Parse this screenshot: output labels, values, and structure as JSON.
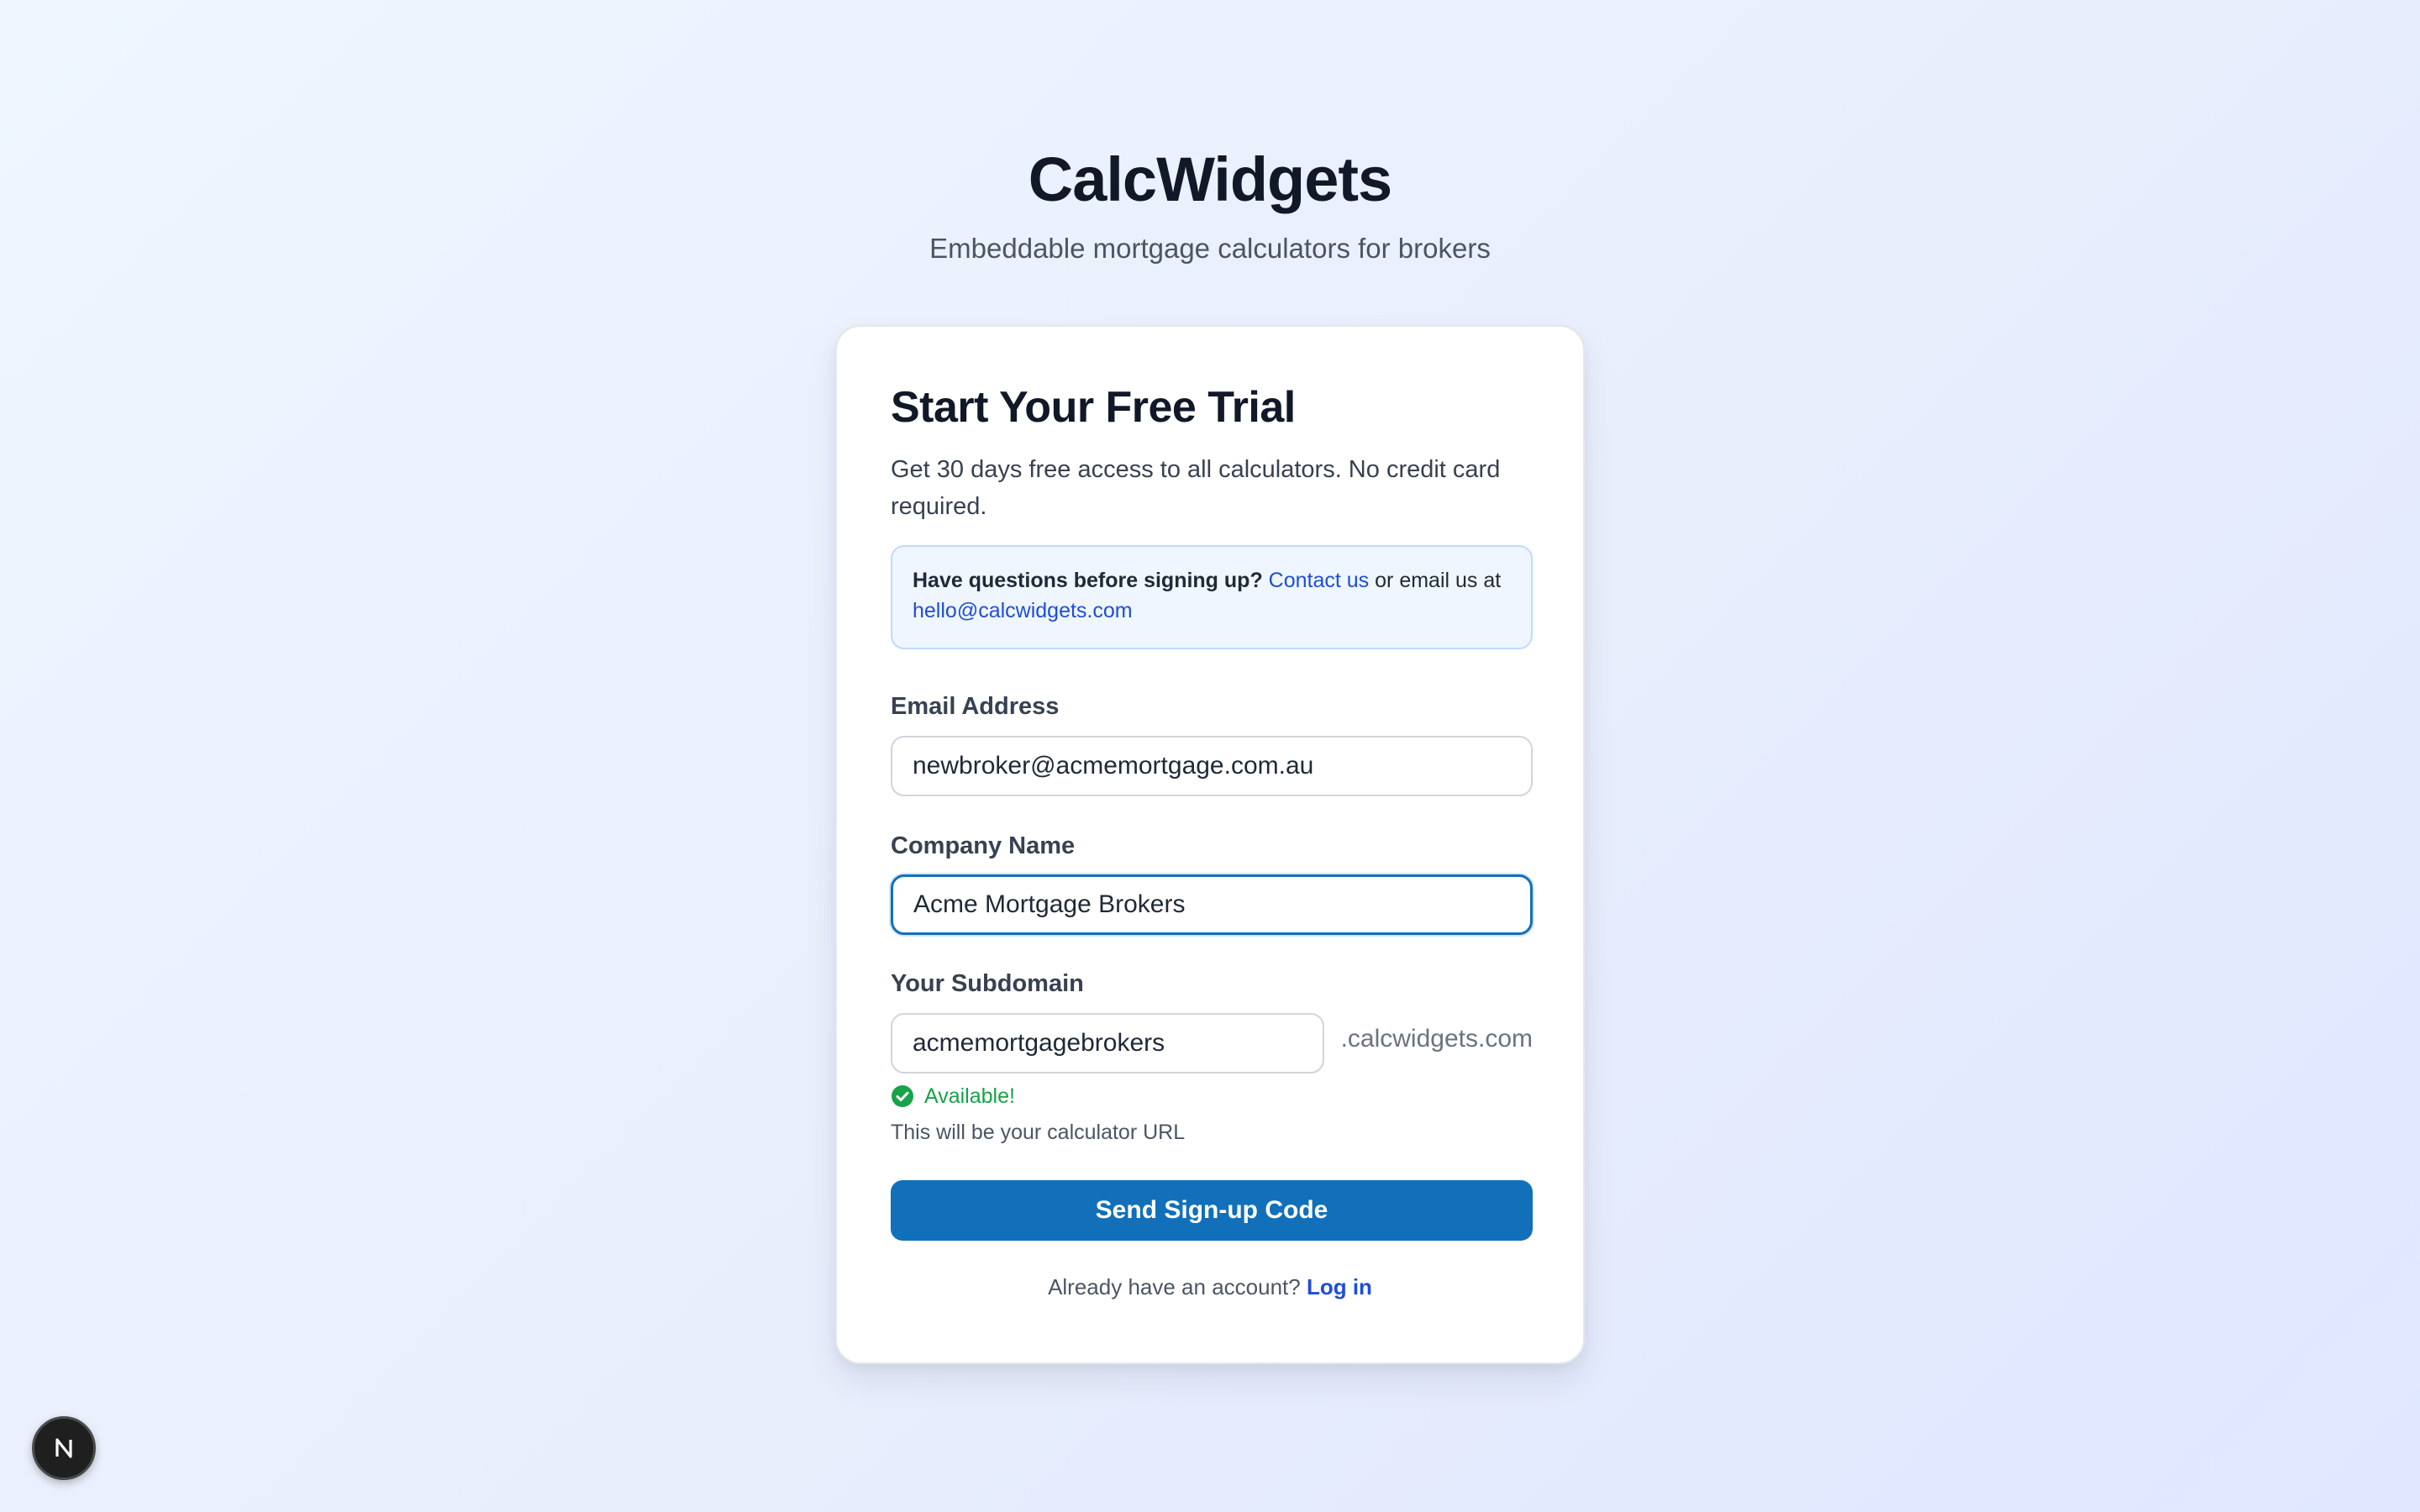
{
  "header": {
    "title": "CalcWidgets",
    "tagline": "Embeddable mortgage calculators for brokers"
  },
  "card": {
    "title": "Start Your Free Trial",
    "subtitle": "Get 30 days free access to all calculators. No credit card required.",
    "info": {
      "question": "Have questions before signing up?",
      "contact_link": "Contact us",
      "middle_text": "or email us at",
      "email_link": "hello@calcwidgets.com"
    },
    "email": {
      "label": "Email Address",
      "value": "newbroker@acmemortgage.com.au"
    },
    "company": {
      "label": "Company Name",
      "value": "Acme Mortgage Brokers"
    },
    "subdomain": {
      "label": "Your Subdomain",
      "value": "acmemortgagebrokers",
      "suffix": ".calcwidgets.com",
      "status": "Available!",
      "hint": "This will be your calculator URL"
    },
    "submit_label": "Send Sign-up Code",
    "footer": {
      "text": "Already have an account?",
      "login_link": "Log in"
    }
  },
  "colors": {
    "primary": "#1170b9",
    "link": "#1d4ed8",
    "success": "#16a34a",
    "info_bg": "#eff6ff",
    "info_border": "#bfdbfe"
  },
  "icons": {
    "status": "check-circle-icon",
    "badge": "nextjs-logo-icon"
  }
}
